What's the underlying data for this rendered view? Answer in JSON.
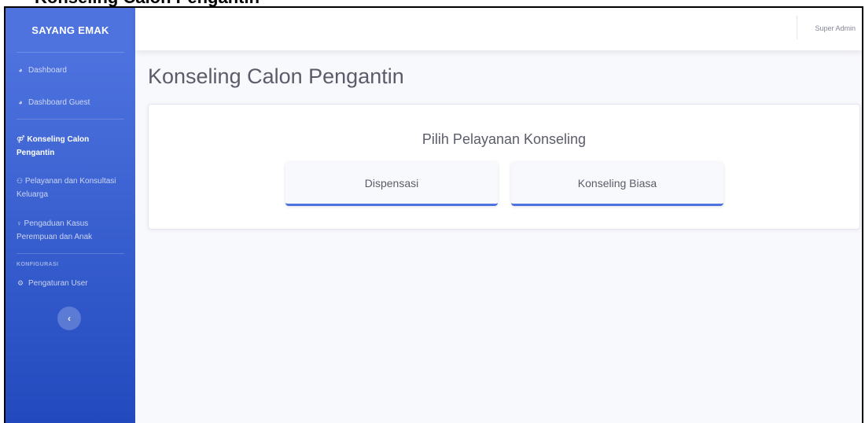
{
  "caption": {
    "text": "Konseling Calon Pengantin"
  },
  "sidebar": {
    "brand": "SAYANG EMAK",
    "items": [
      {
        "icon": "dashboard-icon",
        "label": "Dashboard"
      },
      {
        "icon": "dashboard-icon",
        "label": "Dashboard Guest"
      },
      {
        "icon": "couple-icon",
        "label": "Konseling Calon Pengantin",
        "active": true
      },
      {
        "icon": "users-icon",
        "label": "Pelayanan dan Konsultasi Keluarga"
      },
      {
        "icon": "female-icon",
        "label": "Pengaduan Kasus Perempuan dan Anak"
      }
    ],
    "config_heading": "KONFIGURASI",
    "config_items": [
      {
        "icon": "cogs-icon",
        "label": "Pengaturan User"
      }
    ],
    "toggle_glyph": "‹"
  },
  "topbar": {
    "user_name": "Super Admin"
  },
  "page": {
    "title": "Konseling Calon Pengantin",
    "card_title": "Pilih Pelayanan Konseling",
    "options": [
      {
        "label": "Dispensasi"
      },
      {
        "label": "Konseling Biasa"
      }
    ]
  },
  "colors": {
    "sidebar_top": "#4e73df",
    "sidebar_bottom": "#224abe",
    "accent": "#4e73df",
    "background": "#f8f9fc"
  }
}
